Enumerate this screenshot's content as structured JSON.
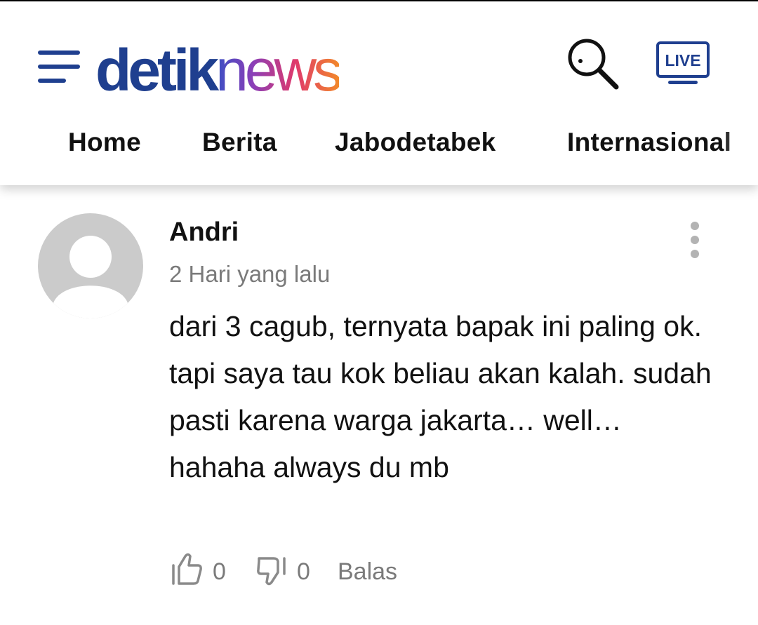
{
  "header": {
    "logo": {
      "part1": "detik",
      "part2": "news"
    },
    "live_label": "LIVE",
    "icons": {
      "menu": "hamburger-menu-icon",
      "search": "search-icon",
      "live": "live-tv-icon"
    },
    "colors": {
      "brand": "#1f3f8f"
    }
  },
  "nav": {
    "tabs": [
      {
        "label": "Home"
      },
      {
        "label": "Berita"
      },
      {
        "label": "Jabodetabek"
      },
      {
        "label": "Internasional"
      }
    ]
  },
  "comment": {
    "author": "Andri",
    "timestamp": "2 Hari yang lalu",
    "text": "dari 3 cagub, ternyata bapak ini paling ok. tapi saya tau kok beliau akan kalah. sudah pasti karena warga jakarta… well… hahaha always du mb",
    "likes": "0",
    "dislikes": "0",
    "reply_label": "Balas",
    "icons": {
      "avatar": "default-avatar-icon",
      "more": "more-vertical-icon",
      "like": "thumbs-up-icon",
      "dislike": "thumbs-down-icon"
    }
  }
}
